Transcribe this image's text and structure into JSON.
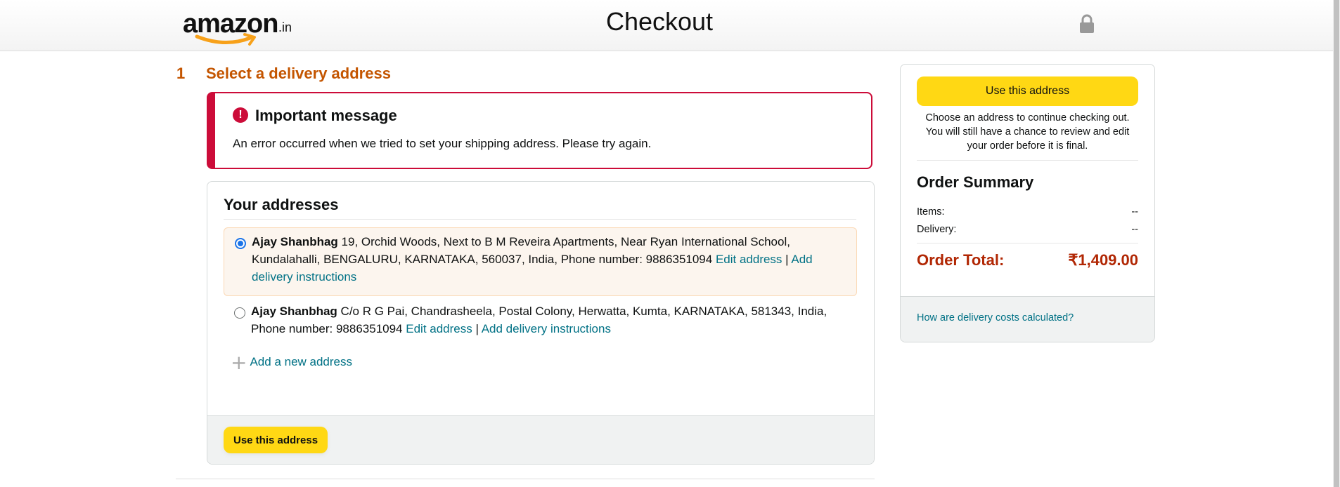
{
  "header": {
    "logo_text": "amazon",
    "logo_suffix": ".in",
    "title": "Checkout",
    "lock_icon": "lock-icon"
  },
  "step": {
    "number": "1",
    "title": "Select a delivery address"
  },
  "alert": {
    "icon": "error-icon",
    "icon_glyph": "!",
    "title": "Important message",
    "body": "An error occurred when we tried to set your shipping address. Please try again."
  },
  "addresses": {
    "heading": "Your addresses",
    "items": [
      {
        "name": "Ajay Shanbhag",
        "address": " 19, Orchid Woods, Next to B M Reveira Apartments, Near Ryan International School, Kundalahalli, BENGALURU, KARNATAKA, 560037, India, Phone number: 9886351094 ",
        "edit_label": "Edit address",
        "separator": " | ",
        "instructions_label": "Add delivery instructions",
        "selected": true
      },
      {
        "name": "Ajay Shanbhag",
        "address": " C/o R G Pai, Chandrasheela, Postal Colony, Herwatta, Kumta, KARNATAKA, 581343, India, Phone number: 9886351094 ",
        "edit_label": "Edit address",
        "separator": " | ",
        "instructions_label": "Add delivery instructions",
        "selected": false
      }
    ],
    "add_new_glyph": "+",
    "add_new_label": "Add a new address",
    "use_button": "Use this address"
  },
  "summary": {
    "use_button": "Use this address",
    "note": "Choose an address to continue checking out. You will still have a chance to review and edit your order before it is final.",
    "heading": "Order Summary",
    "items_label": "Items:",
    "items_value": "--",
    "delivery_label": "Delivery:",
    "delivery_value": "--",
    "total_label": "Order Total:",
    "total_value": "₹1,409.00",
    "delivery_costs_link": "How are delivery costs calculated?"
  },
  "colors": {
    "accent_orange": "#c45500",
    "error_red": "#cc0c39",
    "button_yellow": "#ffd814",
    "link_teal": "#007185",
    "total_red": "#b12704"
  }
}
